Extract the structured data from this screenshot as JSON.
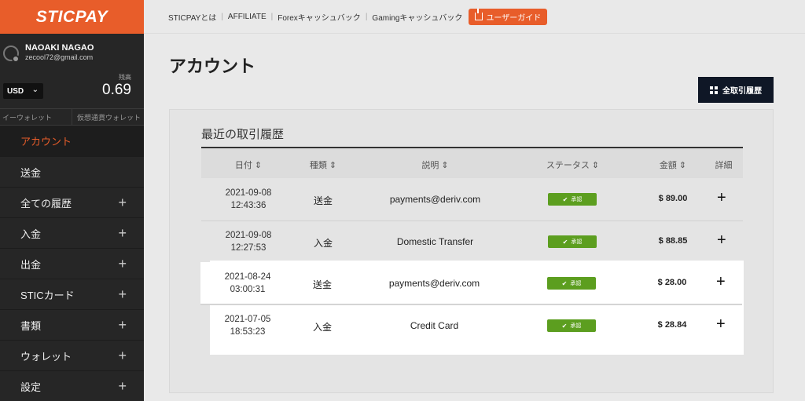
{
  "sidebar": {
    "logo": "STICPAY",
    "user_name": "NAOAKI NAGAO",
    "user_email": "zecool72@gmail.com",
    "currency": "USD",
    "balance_label": "残高",
    "balance_value": "0.69",
    "wallet_tab_1": "イーウォレット",
    "wallet_tab_2": "仮想通貨ウォレット",
    "items": [
      {
        "label": "アカウント"
      },
      {
        "label": "送金"
      },
      {
        "label": "全ての履歴"
      },
      {
        "label": "入金"
      },
      {
        "label": "出金"
      },
      {
        "label": "STICカード"
      },
      {
        "label": "書類"
      },
      {
        "label": "ウォレット"
      },
      {
        "label": "設定"
      }
    ],
    "plus": "+"
  },
  "topnav": {
    "items": [
      "STICPAYとは",
      "AFFILIATE",
      "Forexキャッシュバック",
      "Gamingキャッシュバック"
    ],
    "guide": "ユーザーガイド"
  },
  "page": {
    "title": "アカウント",
    "all_history_button": "全取引履歴"
  },
  "card": {
    "title": "最近の取引履歴",
    "headers": {
      "date": "日付 ⇕",
      "type": "種類 ⇕",
      "desc": "説明 ⇕",
      "status": "ステータス ⇕",
      "amount": "金額 ⇕",
      "detail": "詳細"
    },
    "rows": [
      {
        "date": "2021-09-08",
        "time": "12:43:36",
        "type": "送金",
        "desc": "payments@deriv.com",
        "status": "承認",
        "amount": "$ 89.00"
      },
      {
        "date": "2021-09-08",
        "time": "12:27:53",
        "type": "入金",
        "desc": "Domestic Transfer",
        "status": "承認",
        "amount": "$ 88.85"
      },
      {
        "date": "2021-08-24",
        "time": "03:00:31",
        "type": "送金",
        "desc": "payments@deriv.com",
        "status": "承認",
        "amount": "$ 28.00"
      },
      {
        "date": "2021-07-05",
        "time": "18:53:23",
        "type": "入金",
        "desc": "Credit Card",
        "status": "承認",
        "amount": "$ 28.84"
      }
    ]
  }
}
